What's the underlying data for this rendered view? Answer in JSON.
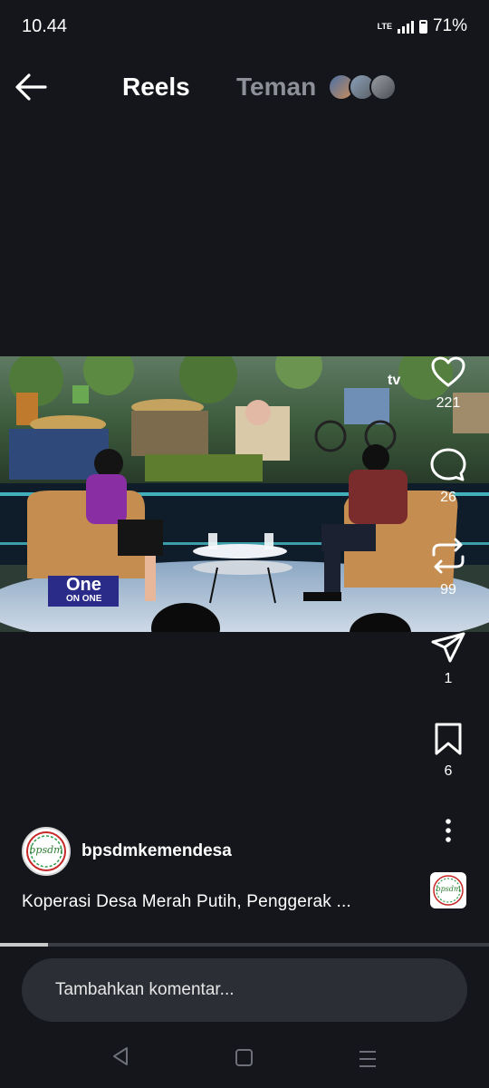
{
  "status_bar": {
    "time": "10.44",
    "network": "LTE",
    "battery": "71%"
  },
  "header": {
    "tabs": [
      {
        "label": "Reels"
      },
      {
        "label": "Teman"
      }
    ]
  },
  "video": {
    "channel_logo_text": "tv",
    "show_logo_top": "One",
    "show_logo_bottom": "ON ONE"
  },
  "actions": {
    "likes": "221",
    "comments": "26",
    "reposts": "99",
    "shares": "1",
    "saves": "6"
  },
  "post": {
    "author": "bpsdmkemendesa",
    "avatar_logo_text": "bpsdm",
    "caption": "Koperasi Desa Merah Putih, Penggerak ..."
  },
  "progress": {
    "played_fraction": 0.098
  },
  "comment_box": {
    "placeholder": "Tambahkan komentar..."
  },
  "colors": {
    "background": "#14161b",
    "inactive_tab": "#8d9098",
    "input_bg": "#2b2e34"
  },
  "icons": [
    "back-arrow-icon",
    "heart-icon",
    "comment-icon",
    "repost-icon",
    "share-icon",
    "bookmark-icon",
    "more-options-icon",
    "nav-back-icon",
    "nav-home-icon",
    "nav-recents-icon"
  ]
}
